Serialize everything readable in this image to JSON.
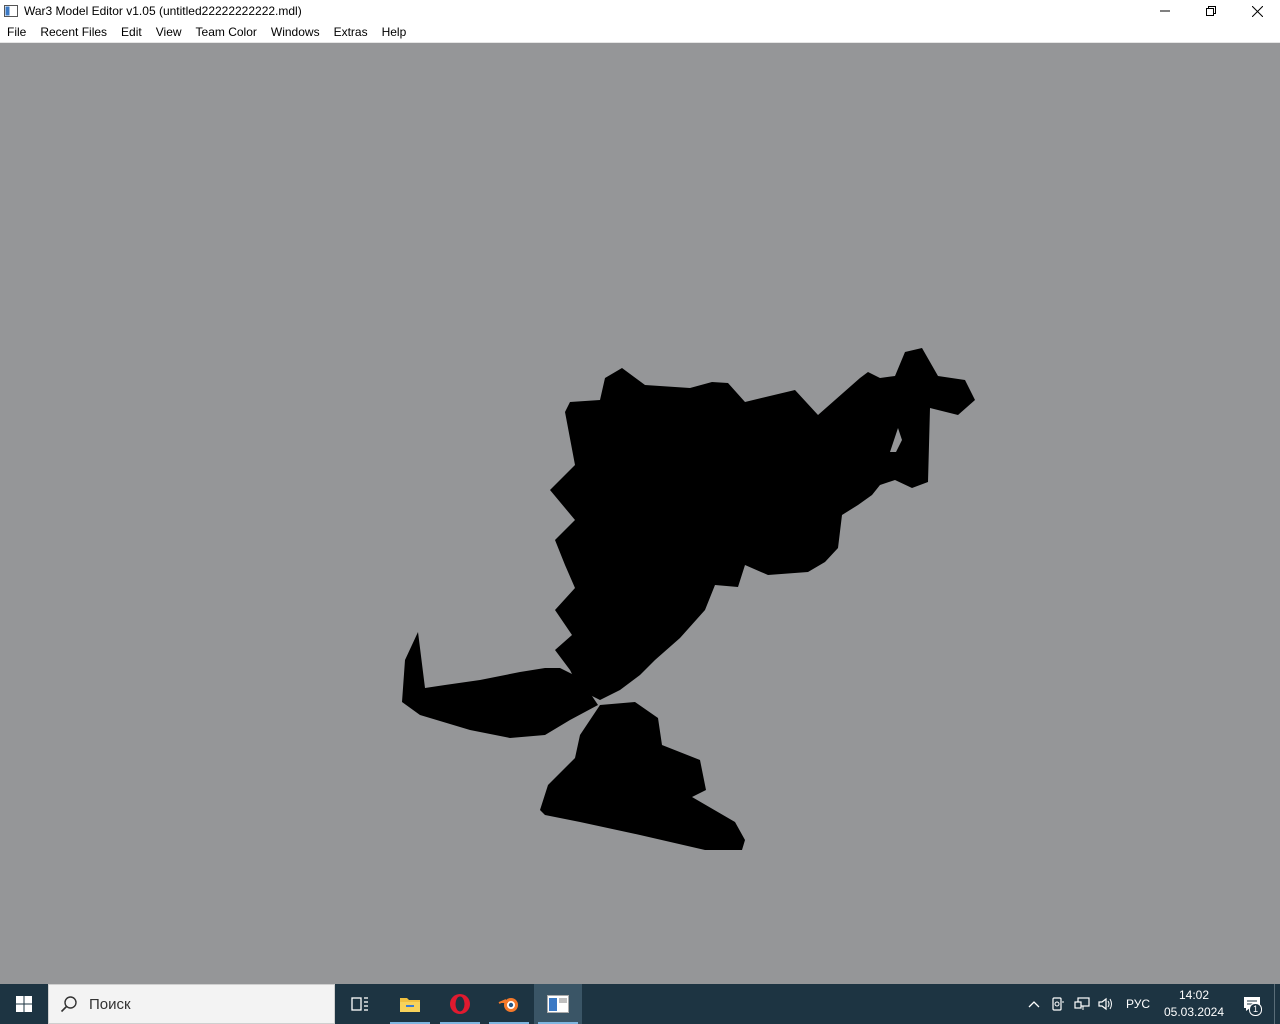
{
  "window": {
    "title": "War3 Model Editor v1.05 (untitled22222222222.mdl)",
    "icon": "app-window-icon",
    "controls": [
      "minimize-icon",
      "restore-icon",
      "close-icon"
    ]
  },
  "menu": {
    "items": [
      {
        "label": "File"
      },
      {
        "label": "Recent Files"
      },
      {
        "label": "Edit"
      },
      {
        "label": "View"
      },
      {
        "label": "Team Color"
      },
      {
        "label": "Windows"
      },
      {
        "label": "Extras"
      },
      {
        "label": "Help"
      }
    ]
  },
  "viewport": {
    "background": "#959698",
    "model_color": "#000000"
  },
  "taskbar": {
    "search_placeholder": "Поиск",
    "apps": [
      {
        "name": "task-view-icon"
      },
      {
        "name": "file-explorer-icon"
      },
      {
        "name": "opera-icon"
      },
      {
        "name": "blender-icon"
      },
      {
        "name": "war3-model-editor-icon"
      }
    ],
    "tray": {
      "language": "РУС",
      "time": "14:02",
      "date": "05.03.2024",
      "notifications": "1"
    }
  }
}
